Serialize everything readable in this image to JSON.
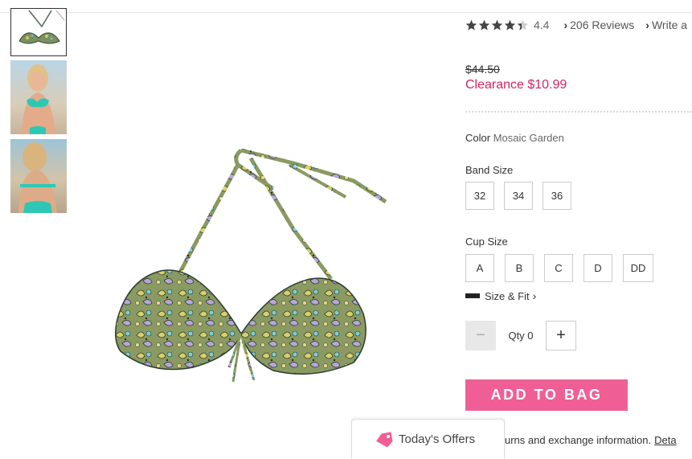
{
  "rating": {
    "value": "4.4",
    "stars_filled": 4.4,
    "reviews_label": "206 Reviews",
    "write_label": "Write a"
  },
  "price": {
    "original": "$44.50",
    "sale": "Clearance $10.99",
    "sale_color": "#d6245f"
  },
  "color": {
    "label": "Color",
    "value": "Mosaic Garden"
  },
  "band_size": {
    "label": "Band Size",
    "options": [
      "32",
      "34",
      "36"
    ]
  },
  "cup_size": {
    "label": "Cup Size",
    "options": [
      "A",
      "B",
      "C",
      "D",
      "DD"
    ]
  },
  "size_fit": {
    "label": "Size & Fit",
    "icon": "ruler-icon"
  },
  "quantity": {
    "label": "Qty 0",
    "minus": "−",
    "plus": "+"
  },
  "add_to_bag": {
    "label": "ADD TO BAG",
    "color": "#ef5f96"
  },
  "returns": {
    "text": "urns and exchange information.",
    "link": "Deta"
  },
  "offers": {
    "label": "Today's Offers",
    "icon": "tag-icon",
    "icon_color": "#ef5f96"
  },
  "thumbnails": [
    {
      "icon": "thumbnail-bikini-top-product"
    },
    {
      "icon": "thumbnail-model-front"
    },
    {
      "icon": "thumbnail-model-back"
    }
  ]
}
